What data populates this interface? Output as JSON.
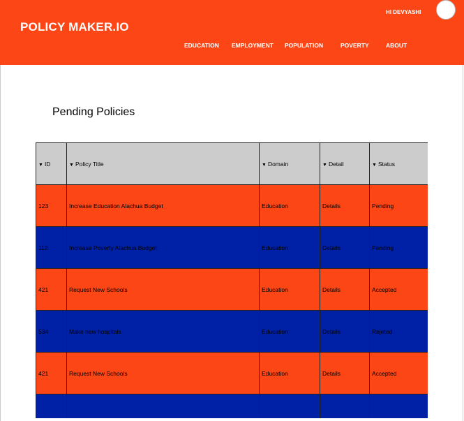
{
  "header": {
    "brand": "POLICY MAKER.IO",
    "greeting": "HI DEVYASHI",
    "nav": [
      {
        "label": "EDUCATION"
      },
      {
        "label": "EMPLOYMENT"
      },
      {
        "label": "POPULATION"
      },
      {
        "label": "POVERTY"
      },
      {
        "label": "ABOUT"
      }
    ]
  },
  "main": {
    "title": "Pending Policies",
    "table": {
      "columns": [
        "ID",
        "Policy Title",
        "Domain",
        "Detail",
        "Status"
      ],
      "rows": [
        {
          "id": "123",
          "title": "Increase Education Alachua Budget",
          "domain": "Education",
          "detail": "Details",
          "status": "Pending"
        },
        {
          "id": "112",
          "title": "Increase Poverty Alachua Budget",
          "domain": "Education",
          "detail": "Details",
          "status": "Pending"
        },
        {
          "id": "421",
          "title": "Request New Schools",
          "domain": "Education",
          "detail": "Details",
          "status": "Accepted"
        },
        {
          "id": "534",
          "title": "Make new hospitals",
          "domain": "Education",
          "detail": "Details",
          "status": "Rejeted"
        },
        {
          "id": "421",
          "title": "Request New Schools",
          "domain": "Education",
          "detail": "Details",
          "status": "Accepted"
        },
        {
          "id": "",
          "title": "",
          "domain": "",
          "detail": "",
          "status": ""
        }
      ]
    }
  },
  "colors": {
    "brand_orange": "#fc4616",
    "row_blue": "#0021a5",
    "header_gray": "#cccccc"
  },
  "icons": {
    "sort": "triangle-down"
  }
}
